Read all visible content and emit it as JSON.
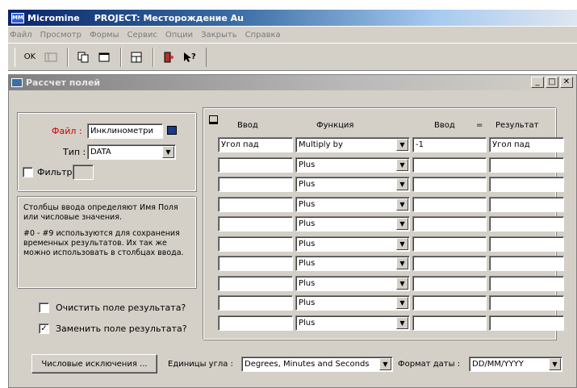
{
  "app": {
    "name": "Micromine",
    "project": "PROJECT: Месторождение Au",
    "logo": "MM"
  },
  "menu": [
    "Файл",
    "Просмотр",
    "Формы",
    "Сервис",
    "Опции",
    "Закрыть",
    "Справка"
  ],
  "toolbar": {
    "ok_label": "OK",
    "icons": [
      "ok-icon",
      "calculator-icon",
      "copy-icon",
      "window-icon",
      "form-icon",
      "exit-icon",
      "help-pointer-icon"
    ]
  },
  "window": {
    "title": "Рассчет полей",
    "controls": [
      "_",
      "□",
      "✕"
    ]
  },
  "file": {
    "label": "Файл :",
    "value": "Инклинометри"
  },
  "type": {
    "label": "Тип :",
    "value": "DATA"
  },
  "filter": {
    "label": "Фильтр"
  },
  "info": {
    "p1": "Столбцы ввода определяют Имя Поля или числовые значения.",
    "p2": "#0 - #9 используются для сохранения временных результатов. Их так же можно использовать в столбцах ввода."
  },
  "options": {
    "clear_result": {
      "label": "Очистить поле результата?",
      "checked": false
    },
    "replace_result": {
      "label": "Заменить поле результата?",
      "checked": true
    }
  },
  "grid": {
    "headers": {
      "input1": "Ввод",
      "function": "Функция",
      "input2": "Ввод",
      "equals": "=",
      "result": "Результат"
    },
    "rows": [
      {
        "input1": "Угол пад",
        "function": "Multiply by",
        "input2": "-1",
        "result": "Угол пад"
      },
      {
        "input1": "",
        "function": "Plus",
        "input2": "",
        "result": ""
      },
      {
        "input1": "",
        "function": "Plus",
        "input2": "",
        "result": ""
      },
      {
        "input1": "",
        "function": "Plus",
        "input2": "",
        "result": ""
      },
      {
        "input1": "",
        "function": "Plus",
        "input2": "",
        "result": ""
      },
      {
        "input1": "",
        "function": "Plus",
        "input2": "",
        "result": ""
      },
      {
        "input1": "",
        "function": "Plus",
        "input2": "",
        "result": ""
      },
      {
        "input1": "",
        "function": "Plus",
        "input2": "",
        "result": ""
      },
      {
        "input1": "",
        "function": "Plus",
        "input2": "",
        "result": ""
      },
      {
        "input1": "",
        "function": "Plus",
        "input2": "",
        "result": ""
      }
    ]
  },
  "footer": {
    "numeric_exceptions": "Числовые исключения ...",
    "angle_units_label": "Единицы угла :",
    "angle_units_value": "Degrees, Minutes and Seconds",
    "date_format_label": "Формат даты :",
    "date_format_value": "DD/MM/YYYY"
  },
  "colors": {
    "file_label": "#cc0000",
    "titlebar": "#0a246a",
    "face": "#d4d0c8"
  }
}
